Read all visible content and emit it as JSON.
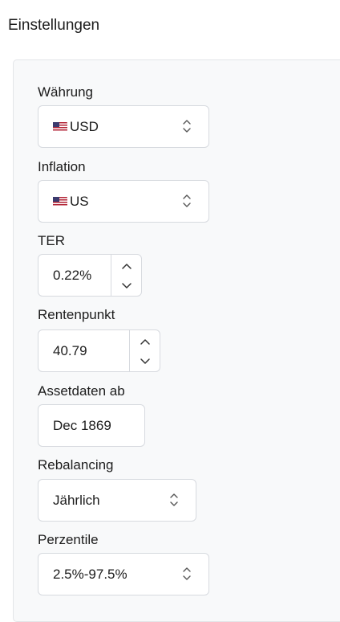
{
  "page": {
    "title": "Einstellungen"
  },
  "settings": {
    "currency": {
      "label": "Währung",
      "value": "USD",
      "flag_icon": "us-flag-icon"
    },
    "inflation": {
      "label": "Inflation",
      "value": "US",
      "flag_icon": "us-flag-icon"
    },
    "ter": {
      "label": "TER",
      "value": "0.22%"
    },
    "pension_point": {
      "label": "Rentenpunkt",
      "value": "40.79"
    },
    "asset_data_from": {
      "label": "Assetdaten ab",
      "value": "Dec 1869"
    },
    "rebalancing": {
      "label": "Rebalancing",
      "value": "Jährlich"
    },
    "percentiles": {
      "label": "Perzentile",
      "value": "2.5%-97.5%"
    }
  },
  "icons": {
    "select_arrows": "up-down-chevron-icon",
    "spinner_up": "chevron-up-icon",
    "spinner_down": "chevron-down-icon"
  },
  "colors": {
    "panel_background": "#f8f9fa",
    "control_border": "#d7dadf",
    "text": "#1c1c1c"
  }
}
